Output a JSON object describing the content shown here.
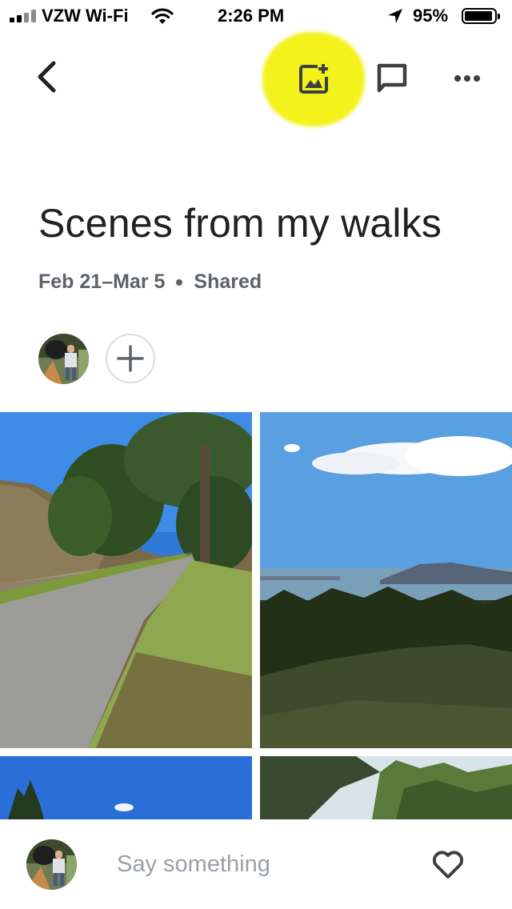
{
  "status_bar": {
    "carrier": "VZW Wi-Fi",
    "time": "2:26 PM",
    "battery": "95%",
    "battery_level": 0.95
  },
  "toolbar": {
    "back_icon": "chevron-left-icon",
    "add_photos_icon": "add-photo-icon",
    "comments_icon": "comment-icon",
    "more_icon": "more-horizontal-icon"
  },
  "album": {
    "title": "Scenes from my walks",
    "date_range": "Feb 21–Mar 5",
    "sharing": "Shared"
  },
  "members": {
    "add_icon": "plus-icon"
  },
  "comment_bar": {
    "placeholder": "Say something",
    "like_icon": "heart-icon"
  },
  "colors": {
    "highlight": "#f4f21b",
    "text_primary": "#202124",
    "text_secondary": "#5f6368",
    "placeholder": "#9aa0a6"
  }
}
